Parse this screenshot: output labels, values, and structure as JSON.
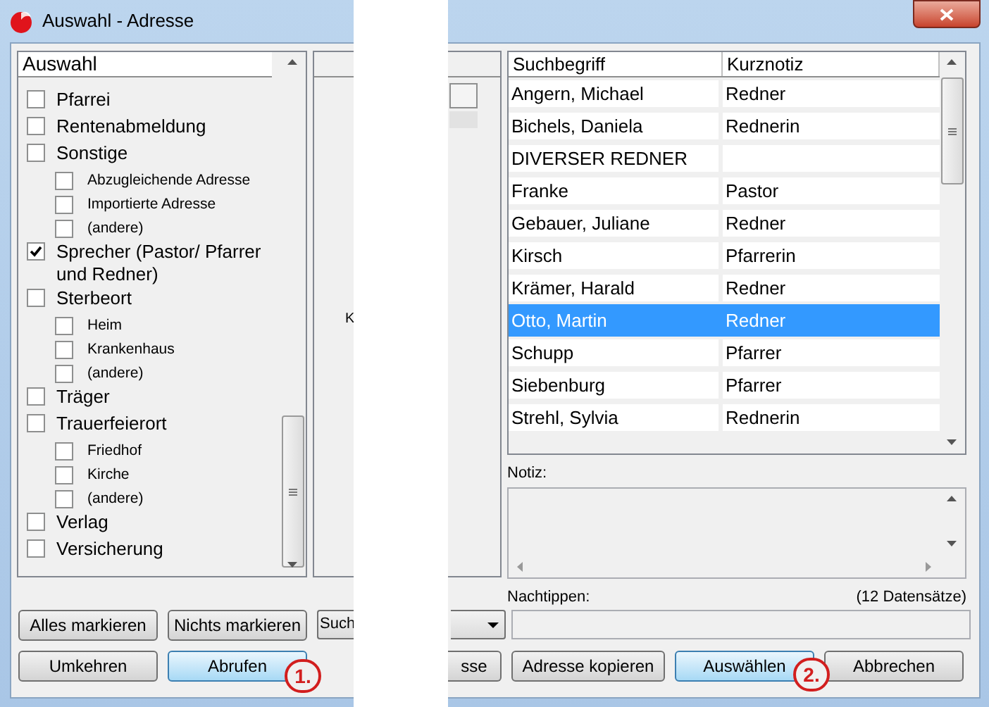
{
  "window": {
    "title": "Auswahl - Adresse"
  },
  "selection": {
    "header": "Auswahl",
    "items": [
      {
        "label": "Pfarrei",
        "checked": false
      },
      {
        "label": "Rentenabmeldung",
        "checked": false
      },
      {
        "label": "Sonstige",
        "checked": false,
        "children": [
          {
            "label": "Abzugleichende Adresse",
            "checked": false
          },
          {
            "label": "Importierte Adresse",
            "checked": false
          },
          {
            "label": "(andere)",
            "checked": false
          }
        ]
      },
      {
        "label": "Sprecher (Pastor/ Pfarrer und Redner)",
        "checked": true
      },
      {
        "label": "Sterbeort",
        "checked": false,
        "children": [
          {
            "label": "Heim",
            "checked": false
          },
          {
            "label": "Krankenhaus",
            "checked": false
          },
          {
            "label": "(andere)",
            "checked": false
          }
        ]
      },
      {
        "label": "Träger",
        "checked": false
      },
      {
        "label": "Trauerfeierort",
        "checked": false,
        "children": [
          {
            "label": "Friedhof",
            "checked": false
          },
          {
            "label": "Kirche",
            "checked": false
          },
          {
            "label": "(andere)",
            "checked": false
          }
        ]
      },
      {
        "label": "Verlag",
        "checked": false
      },
      {
        "label": "Versicherung",
        "checked": false
      }
    ]
  },
  "middle_panel": {
    "label": "K"
  },
  "table": {
    "columns": [
      "Suchbegriff",
      "Kurznotiz"
    ],
    "rows": [
      {
        "cells": [
          "Angern, Michael",
          "Redner"
        ],
        "selected": false
      },
      {
        "cells": [
          "Bichels, Daniela",
          "Rednerin"
        ],
        "selected": false
      },
      {
        "cells": [
          "DIVERSER REDNER",
          ""
        ],
        "selected": false
      },
      {
        "cells": [
          "Franke",
          "Pastor"
        ],
        "selected": false
      },
      {
        "cells": [
          "Gebauer, Juliane",
          "Redner"
        ],
        "selected": false
      },
      {
        "cells": [
          "Kirsch",
          "Pfarrerin"
        ],
        "selected": false
      },
      {
        "cells": [
          "Krämer, Harald",
          "Redner"
        ],
        "selected": false
      },
      {
        "cells": [
          "Otto, Martin",
          "Redner"
        ],
        "selected": true
      },
      {
        "cells": [
          "Schupp",
          "Pfarrer"
        ],
        "selected": false
      },
      {
        "cells": [
          "Siebenburg",
          "Pfarrer"
        ],
        "selected": false
      },
      {
        "cells": [
          "Strehl, Sylvia",
          "Rednerin"
        ],
        "selected": false
      }
    ]
  },
  "note_label": "Notiz:",
  "retype_label": "Nachtippen:",
  "record_count": "(12 Datensätze)",
  "left_buttons": [
    {
      "label": "Alles markieren",
      "highlighted": false
    },
    {
      "label": "Nichts markieren",
      "highlighted": false
    }
  ],
  "search_dropdown": {
    "value": "Such"
  },
  "bottom_buttons": [
    {
      "label": "Umkehren",
      "highlighted": false
    },
    {
      "label": "Abrufen",
      "highlighted": true,
      "callout": "1."
    },
    {
      "label": "sse",
      "highlighted": false
    },
    {
      "label": "Adresse kopieren",
      "highlighted": false
    },
    {
      "label": "Auswählen",
      "highlighted": true,
      "callout": "2."
    },
    {
      "label": "Abbrechen",
      "highlighted": false
    }
  ]
}
